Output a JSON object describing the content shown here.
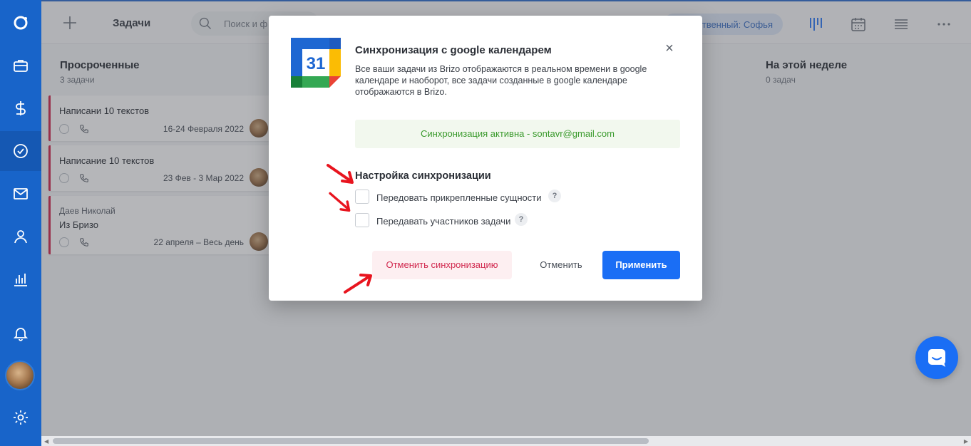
{
  "header": {
    "title": "Задачи",
    "search_placeholder": "Поиск и ф",
    "responsible_chip": "ственный: Софья"
  },
  "columns": [
    {
      "title": "Просроченные",
      "count": "3 задачи"
    },
    {
      "title": "На этой неделе",
      "count": "0 задач"
    }
  ],
  "tasks": [
    {
      "title": "Написани 10 текстов",
      "sub": "",
      "date": "16-24 Февраля 2022"
    },
    {
      "title": "Написание 10 текстов",
      "sub": "",
      "date": "23 Фев - 3 Мар 2022"
    },
    {
      "title": "Из Бризо",
      "sub": "Даев Николай",
      "date": "22 апреля – Весь день"
    }
  ],
  "modal": {
    "calendar_day": "31",
    "title": "Синхронизация с google календарем",
    "description": "Все ваши задачи из Brizo отображаются в реальном времени в google календаре и наоборот, все задачи созданные в google календаре отображаются в Brizo.",
    "status": "Синхронизация активна - sontavr@gmail.com",
    "section_title": "Настройка синхронизации",
    "options": [
      {
        "label": "Передовать прикрепленные сущности",
        "checked": false
      },
      {
        "label": "Передавать участников задачи",
        "checked": false
      }
    ],
    "help_glyph": "?",
    "close_glyph": "×",
    "buttons": {
      "unsync": "Отменить синхронизацию",
      "cancel": "Отменить",
      "apply": "Применить"
    }
  },
  "colors": {
    "sidebar": "#1864c9",
    "accent": "#1a6ef5",
    "danger": "#d1284e",
    "success": "#3a9a2c",
    "annotation_arrow": "#e8141e"
  }
}
